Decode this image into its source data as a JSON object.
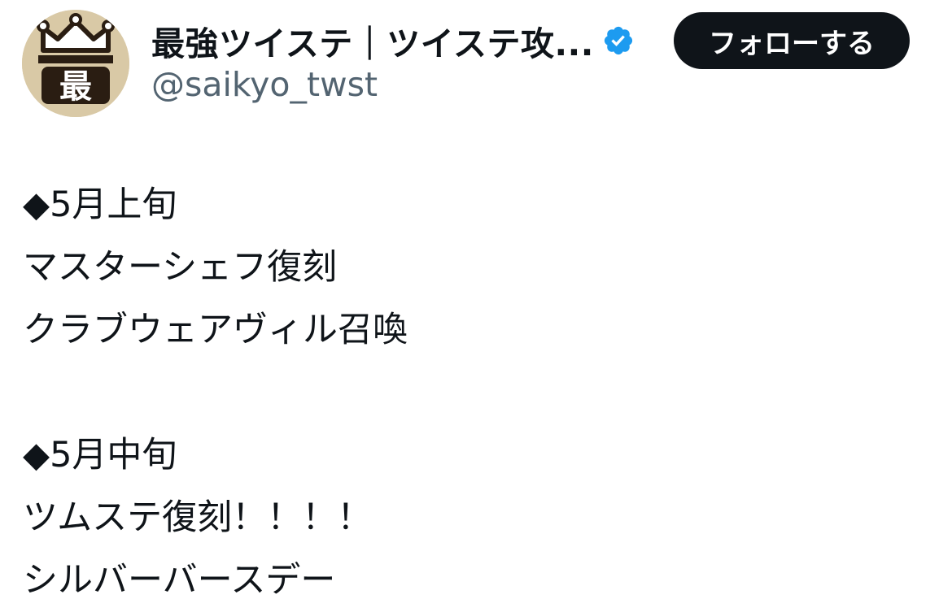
{
  "account": {
    "display_name": "最強ツイステ｜ツイステ攻...",
    "handle": "@saikyo_twst",
    "avatar_text": "最",
    "verified_icon": "verified-badge-icon",
    "verified_color": "#1d9bf0"
  },
  "follow_button": {
    "label": "フォローする"
  },
  "tweet": {
    "lines": [
      "◆5月上旬",
      "マスターシェフ復刻",
      "クラブウェアヴィル召喚",
      "",
      "◆5月中旬",
      "ツムステ復刻！！！！",
      "シルバーバースデー"
    ]
  },
  "colors": {
    "text": "#0f1419",
    "secondary_text": "#536471",
    "button_bg": "#0f1419",
    "button_text": "#ffffff",
    "avatar_bg": "#d9c9a6"
  }
}
